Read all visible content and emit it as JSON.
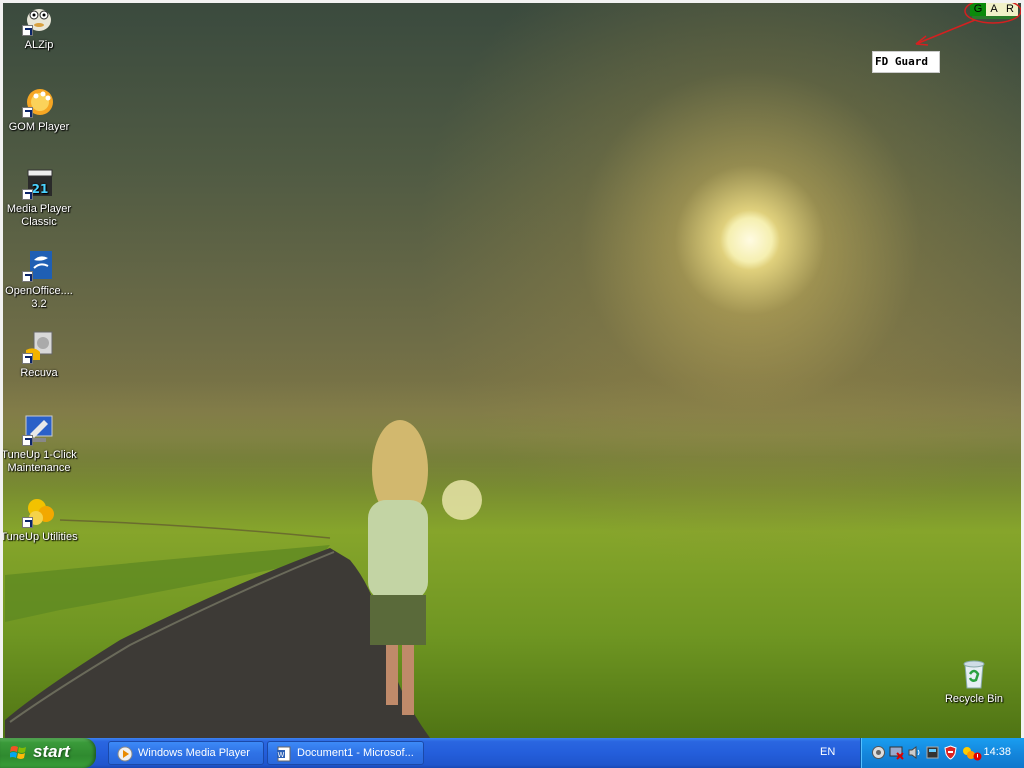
{
  "desktop_icons": [
    {
      "id": "alzip",
      "label": "ALZip",
      "icon": "alzip-icon"
    },
    {
      "id": "gom-player",
      "label": "GOM Player",
      "icon": "gom-player-icon"
    },
    {
      "id": "media-player-classic",
      "label": "Media Player Classic",
      "icon": "media-player-classic-icon"
    },
    {
      "id": "openoffice",
      "label": "OpenOffice.... 3.2",
      "icon": "openoffice-icon"
    },
    {
      "id": "recuva",
      "label": "Recuva",
      "icon": "recuva-icon"
    },
    {
      "id": "tuneup-1click",
      "label": "TuneUp 1-Click Maintenance",
      "icon": "tuneup-1click-icon"
    },
    {
      "id": "tuneup-utilities",
      "label": "TuneUp Utilities",
      "icon": "tuneup-utilities-icon"
    }
  ],
  "recycle_bin": {
    "label": "Recycle Bin",
    "icon": "recycle-bin-icon"
  },
  "overlay": {
    "fd_guard_label": "FD Guard",
    "gar": {
      "g": "G",
      "a": "A",
      "r": "R"
    },
    "colors": {
      "g": "#0b8a0b",
      "annotation": "#d42020"
    }
  },
  "taskbar": {
    "start_label": "start",
    "tasks": [
      {
        "label": "Windows Media Player",
        "icon": "windows-media-player-icon"
      },
      {
        "label": "Document1 - Microsof...",
        "icon": "word-document-icon"
      }
    ],
    "language": "EN",
    "tray_icons": [
      "tray-network-icon",
      "tray-monitor-icon",
      "tray-speaker-icon",
      "tray-app-icon",
      "tray-security-icon",
      "tray-antivirus-icon",
      "tray-alert-icon"
    ],
    "clock": "14:38",
    "colors": {
      "bar": "#245edb",
      "start": "#2f8a2f",
      "tray": "#1487dd"
    }
  }
}
